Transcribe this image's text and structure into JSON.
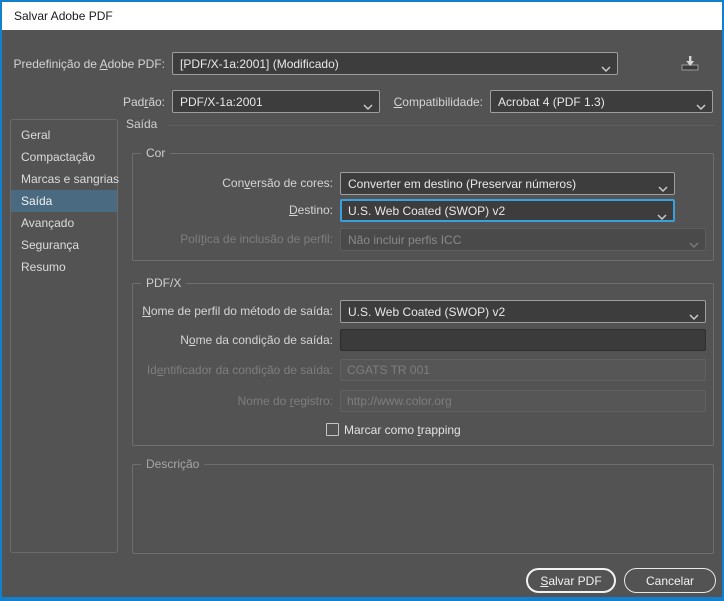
{
  "window": {
    "title": "Salvar Adobe PDF"
  },
  "colors": {
    "window_border": "#1380CE",
    "body_bg": "#535353",
    "focus_accent": "#38A0DC",
    "sidebar_selected_bg": "#4A6A82"
  },
  "toolbar": {
    "preset": {
      "label_pre": "Predefinição de ",
      "label_key": "A",
      "label_post": "dobe PDF:",
      "value": "[PDF/X-1a:2001] (Modificado)"
    },
    "standard": {
      "label_pre": "Pad",
      "label_key": "r",
      "label_post": "ão:",
      "value": "PDF/X-1a:2001"
    },
    "compatibility": {
      "label_pre": "",
      "label_key": "C",
      "label_post": "ompatibilidade:",
      "value": "Acrobat 4 (PDF 1.3)"
    },
    "download_icon": "save-preset-download-icon"
  },
  "sidebar": {
    "items": [
      {
        "label": "Geral",
        "selected": false
      },
      {
        "label": "Compactação",
        "selected": false
      },
      {
        "label": "Marcas e sangrias",
        "selected": false
      },
      {
        "label": "Saída",
        "selected": true
      },
      {
        "label": "Avançado",
        "selected": false
      },
      {
        "label": "Segurança",
        "selected": false
      },
      {
        "label": "Resumo",
        "selected": false
      }
    ]
  },
  "panel": {
    "header": "Saída"
  },
  "color_group": {
    "legend": "Cor",
    "conversion": {
      "label_pre": "Con",
      "label_key": "v",
      "label_post": "ersão de cores:",
      "value": "Converter em destino (Preservar números)"
    },
    "destination": {
      "label_pre": "",
      "label_key": "D",
      "label_post": "estino:",
      "value": "U.S. Web Coated (SWOP) v2",
      "focused": true
    },
    "profile_policy": {
      "label_pre": "Polí",
      "label_key": "t",
      "label_post": "ica de inclusão de perfil:",
      "value": "Não incluir perfis ICC",
      "disabled": true
    }
  },
  "pdfx_group": {
    "legend": "PDF/X",
    "output_intent_profile": {
      "label_pre": "",
      "label_key": "N",
      "label_post": "ome de perfil do método de saída:",
      "value": "U.S. Web Coated (SWOP) v2"
    },
    "output_condition_name": {
      "label_pre": "N",
      "label_key": "o",
      "label_post": "me da condição de saída:",
      "value": ""
    },
    "output_condition_id": {
      "label_pre": "Id",
      "label_key": "e",
      "label_post": "ntificador da condição de saída:",
      "value": "CGATS TR 001",
      "disabled": true
    },
    "registry_name": {
      "label_pre": "Nome do ",
      "label_key": "r",
      "label_post": "egistro:",
      "value": "http://www.color.org",
      "disabled": true
    },
    "trapping_checkbox": {
      "label_pre": "Marcar como ",
      "label_key": "t",
      "label_post": "rapping",
      "checked": false
    }
  },
  "description_group": {
    "legend": "Descrição"
  },
  "footer": {
    "save_button": {
      "label_pre": "",
      "label_key": "S",
      "label_post": "alvar PDF"
    },
    "cancel_button": {
      "label": "Cancelar"
    }
  }
}
